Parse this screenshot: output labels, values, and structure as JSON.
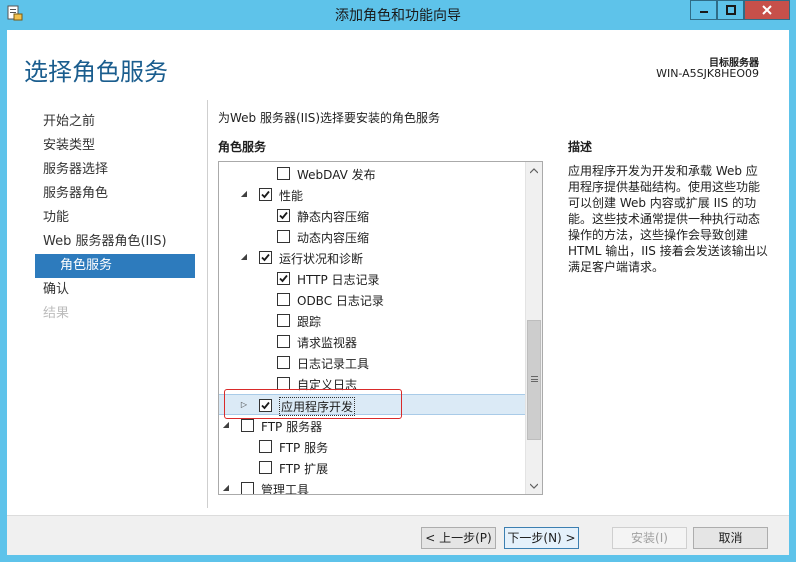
{
  "window": {
    "title": "添加角色和功能向导"
  },
  "header": {
    "title": "选择角色服务",
    "target_label": "目标服务器",
    "target_name": "WIN-A5SJK8HEO09"
  },
  "nav": [
    {
      "label": "开始之前",
      "state": "normal"
    },
    {
      "label": "安装类型",
      "state": "normal"
    },
    {
      "label": "服务器选择",
      "state": "normal"
    },
    {
      "label": "服务器角色",
      "state": "normal"
    },
    {
      "label": "功能",
      "state": "normal"
    },
    {
      "label": "Web 服务器角色(IIS)",
      "state": "normal"
    },
    {
      "label": "角色服务",
      "state": "active"
    },
    {
      "label": "确认",
      "state": "normal"
    },
    {
      "label": "结果",
      "state": "disabled"
    }
  ],
  "main": {
    "intro": "为Web 服务器(IIS)选择要安装的角色服务",
    "role_services_header": "角色服务",
    "tree": [
      {
        "label": "WebDAV 发布",
        "level": 3,
        "checked": false,
        "expander": ""
      },
      {
        "label": "性能",
        "level": 2,
        "checked": true,
        "expander": "expanded"
      },
      {
        "label": "静态内容压缩",
        "level": 3,
        "checked": true,
        "expander": ""
      },
      {
        "label": "动态内容压缩",
        "level": 3,
        "checked": false,
        "expander": ""
      },
      {
        "label": "运行状况和诊断",
        "level": 2,
        "checked": true,
        "expander": "expanded"
      },
      {
        "label": "HTTP 日志记录",
        "level": 3,
        "checked": true,
        "expander": ""
      },
      {
        "label": "ODBC 日志记录",
        "level": 3,
        "checked": false,
        "expander": ""
      },
      {
        "label": "跟踪",
        "level": 3,
        "checked": false,
        "expander": ""
      },
      {
        "label": "请求监视器",
        "level": 3,
        "checked": false,
        "expander": ""
      },
      {
        "label": "日志记录工具",
        "level": 3,
        "checked": false,
        "expander": ""
      },
      {
        "label": "自定义日志",
        "level": 3,
        "checked": false,
        "expander": ""
      },
      {
        "label": "应用程序开发",
        "level": 2,
        "checked": true,
        "expander": "collapsed",
        "selected": true
      },
      {
        "label": "FTP 服务器",
        "level": 1,
        "checked": false,
        "expander": "expanded"
      },
      {
        "label": "FTP 服务",
        "level": 2,
        "checked": false,
        "expander": ""
      },
      {
        "label": "FTP 扩展",
        "level": 2,
        "checked": false,
        "expander": ""
      },
      {
        "label": "管理工具",
        "level": 1,
        "checked": false,
        "expander": "expanded"
      }
    ]
  },
  "description": {
    "title": "描述",
    "text": "应用程序开发为开发和承载 Web 应用程序提供基础结构。使用这些功能可以创建 Web 内容或扩展 IIS 的功能。这些技术通常提供一种执行动态操作的方法，这些操作会导致创建 HTML 输出，IIS 接着会发送该输出以满足客户端请求。"
  },
  "footer": {
    "prev_label": "< 上一步(P)",
    "next_label": "下一步(N) >",
    "install_label": "安装(I)",
    "cancel_label": "取消"
  }
}
